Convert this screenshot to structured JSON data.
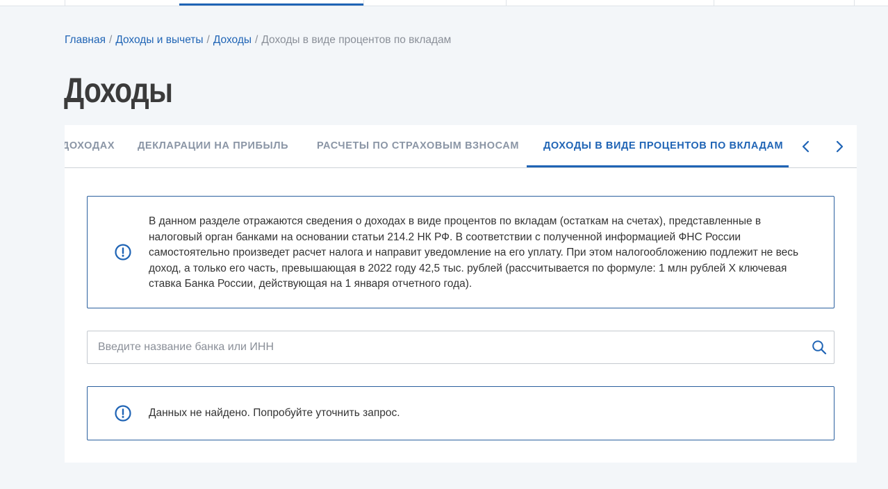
{
  "breadcrumb": {
    "items": [
      "Главная",
      "Доходы и вычеты",
      "Доходы"
    ],
    "current": "Доходы в виде процентов по вкладам",
    "separator": "/"
  },
  "page": {
    "title": "Доходы"
  },
  "tabs": {
    "items": [
      {
        "label": "ДОХОДАХ"
      },
      {
        "label": "ДЕКЛАРАЦИИ НА ПРИБЫЛЬ"
      },
      {
        "label": "РАСЧЕТЫ ПО СТРАХОВЫМ ВЗНОСАМ"
      },
      {
        "label": "ДОХОДЫ В ВИДЕ ПРОЦЕНТОВ ПО ВКЛАДАМ"
      }
    ],
    "active_index": 3
  },
  "info": {
    "icon": "exclamation-circle-icon",
    "text": "В данном разделе отражаются сведения о доходах в виде процентов по вкладам (остаткам на счетах), представленные в налоговый орган банками на основании статьи 214.2 НК РФ. В соответствии с полученной информацией ФНС России самостоятельно произведет расчет налога и направит уведомление на его уплату. При этом налогообложению подлежит не весь доход, а только его часть, превышающая в 2022 году 42,5 тыс. рублей (рассчитывается по формуле: 1 млн рублей Х ключевая ставка Банка России, действующая на 1 января отчетного года)."
  },
  "search": {
    "placeholder": "Введите название банка или ИНН",
    "value": ""
  },
  "empty": {
    "icon": "exclamation-circle-icon",
    "text": "Данных не найдено. Попробуйте уточнить запрос."
  },
  "colors": {
    "accent": "#1f64b5",
    "background": "#f3f6f9",
    "box_border": "#2a5f9e"
  }
}
